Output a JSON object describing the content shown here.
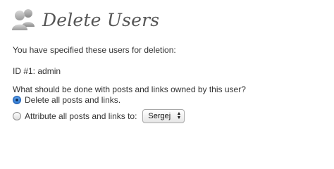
{
  "header": {
    "title": "Delete Users",
    "icon": "users-icon"
  },
  "intro_text": "You have specified these users for deletion:",
  "users": [
    {
      "label": "ID #1: admin"
    }
  ],
  "question": "What should be done with posts and links owned by this user?",
  "options": {
    "delete": {
      "label": "Delete all posts and links.",
      "checked": true
    },
    "attribute": {
      "label": "Attribute all posts and links to:",
      "checked": false
    }
  },
  "attribute_select": {
    "selected": "Sergej"
  },
  "colors": {
    "title": "#555555",
    "text": "#333333",
    "radio_selected": "#3b86dc"
  }
}
